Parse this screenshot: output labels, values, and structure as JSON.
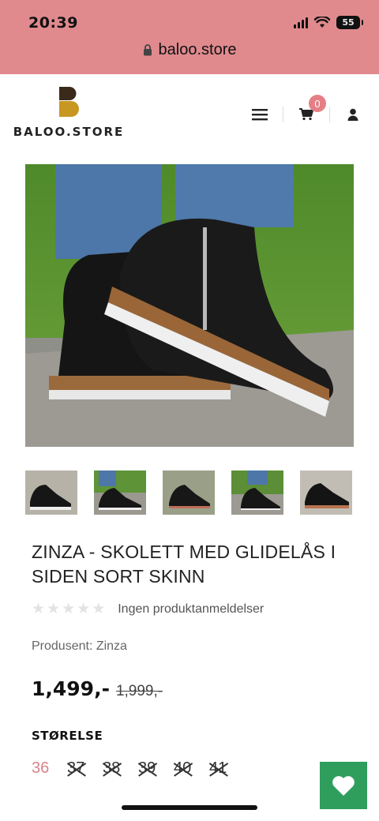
{
  "status_bar": {
    "time": "20:39",
    "battery": "55"
  },
  "browser": {
    "url": "baloo.store"
  },
  "header": {
    "logo_text": "BALOO.STORE",
    "cart_count": "0"
  },
  "product": {
    "title": "ZINZA - SKOLETT MED GLIDELÅS I SIDEN SORT SKINN",
    "rating_stars": 0,
    "reviews_text": "Ingen produktanmeldelser",
    "manufacturer": "Produsent: Zinza",
    "price": "1,499,-",
    "old_price": "1,999,-",
    "size_label": "STØRELSE",
    "sizes": [
      {
        "label": "36",
        "available": true
      },
      {
        "label": "37",
        "available": false
      },
      {
        "label": "38",
        "available": false
      },
      {
        "label": "39",
        "available": false
      },
      {
        "label": "40",
        "available": false
      },
      {
        "label": "41",
        "available": false
      }
    ]
  },
  "colors": {
    "accent_pink": "#e08a8e",
    "wishlist_green": "#2f9e5d"
  },
  "icons": [
    "lock-icon",
    "menu-icon",
    "cart-icon",
    "user-icon",
    "heart-icon",
    "star-icon"
  ]
}
